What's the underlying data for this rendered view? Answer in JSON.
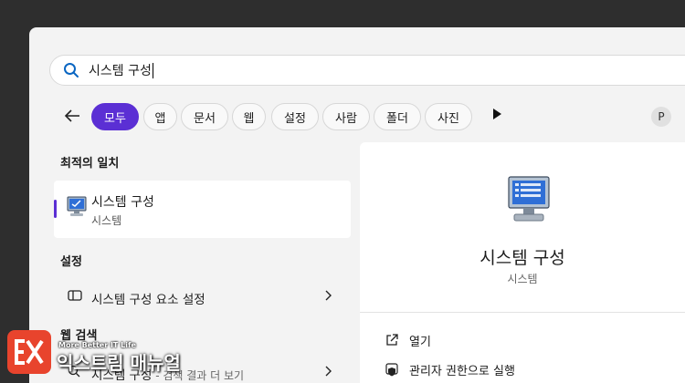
{
  "search": {
    "value": "시스템 구성"
  },
  "filters": {
    "chips": [
      {
        "label": "모두",
        "active": true
      },
      {
        "label": "앱"
      },
      {
        "label": "문서"
      },
      {
        "label": "웹"
      },
      {
        "label": "설정"
      },
      {
        "label": "사람"
      },
      {
        "label": "폴더"
      },
      {
        "label": "사진"
      }
    ],
    "profile_initial": "P"
  },
  "sections": {
    "best_match": "최적의 일치",
    "settings": "설정",
    "web_search": "웹 검색"
  },
  "best_match": {
    "title": "시스템 구성",
    "subtitle": "시스템"
  },
  "settings_results": [
    {
      "label": "시스템 구성 요소 설정"
    }
  ],
  "web_results": [
    {
      "label": "시스템 구성",
      "suffix": " - 검색 결과 더 보기"
    }
  ],
  "detail": {
    "title": "시스템 구성",
    "subtitle": "시스템",
    "actions": [
      {
        "label": "열기",
        "icon": "open-external-icon"
      },
      {
        "label": "관리자 권한으로 실행",
        "icon": "shield-icon"
      }
    ]
  },
  "watermark": {
    "tagline": "More Better IT Life",
    "title": "익스트림 매뉴얼"
  },
  "colors": {
    "accent": "#5b2fd4",
    "panel": "#f3f3f3",
    "desktop": "#2e2e2e",
    "brand": "#e8442d"
  }
}
